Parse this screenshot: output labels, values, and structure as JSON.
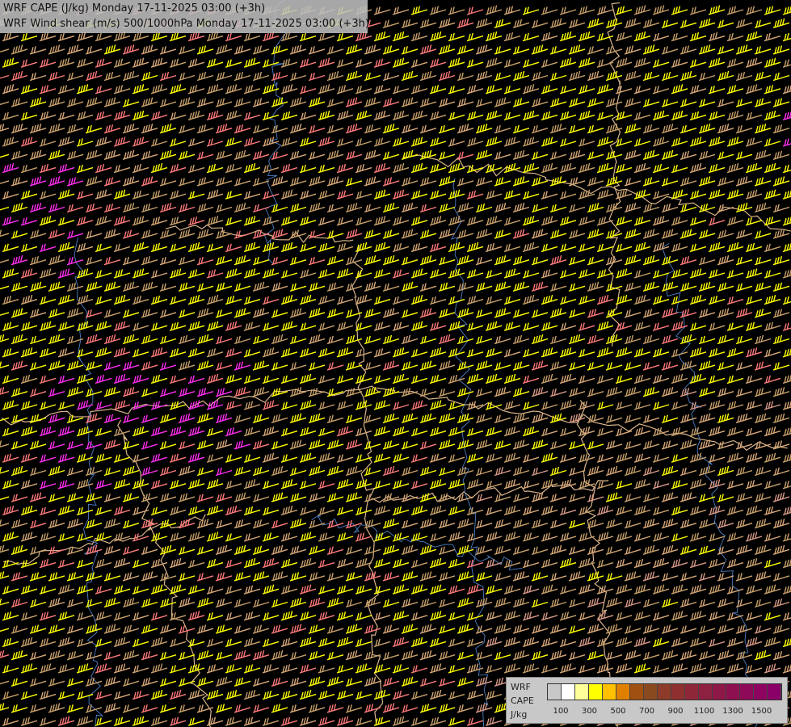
{
  "title": {
    "line1": "WRF CAPE (J/kg) Monday 17-11-2025 03:00 (+3h)",
    "line2": "WRF Wind shear (m/s) 500/1000hPa Monday 17-11-2025 03:00 (+3h)"
  },
  "legend": {
    "model": "WRF",
    "variable": "CAPE",
    "unit": "J/kg",
    "colors": [
      "#c8c8c8",
      "#ffffff",
      "#ffff99",
      "#ffff00",
      "#ffc000",
      "#e08000",
      "#a05010",
      "#8a4a20",
      "#8c3c28",
      "#8e3030",
      "#8e2838",
      "#8e2040",
      "#8e1848",
      "#8e1050",
      "#8e0a58",
      "#8e0460",
      "#8a0068"
    ],
    "ticks": [
      "100",
      "300",
      "500",
      "700",
      "900",
      "1100",
      "1300",
      "1500"
    ]
  },
  "map": {
    "background": "#000000",
    "shear_colors": {
      "light_brown": "#c8a06a",
      "tan": "#d7a878",
      "yellow": "#ffff00",
      "salmon": "#ff7a7a",
      "magenta": "#ff2ff0",
      "pink_tan": "#d89a88"
    },
    "border_color": "#d9b48c",
    "river_color": "#4d7fc4"
  }
}
